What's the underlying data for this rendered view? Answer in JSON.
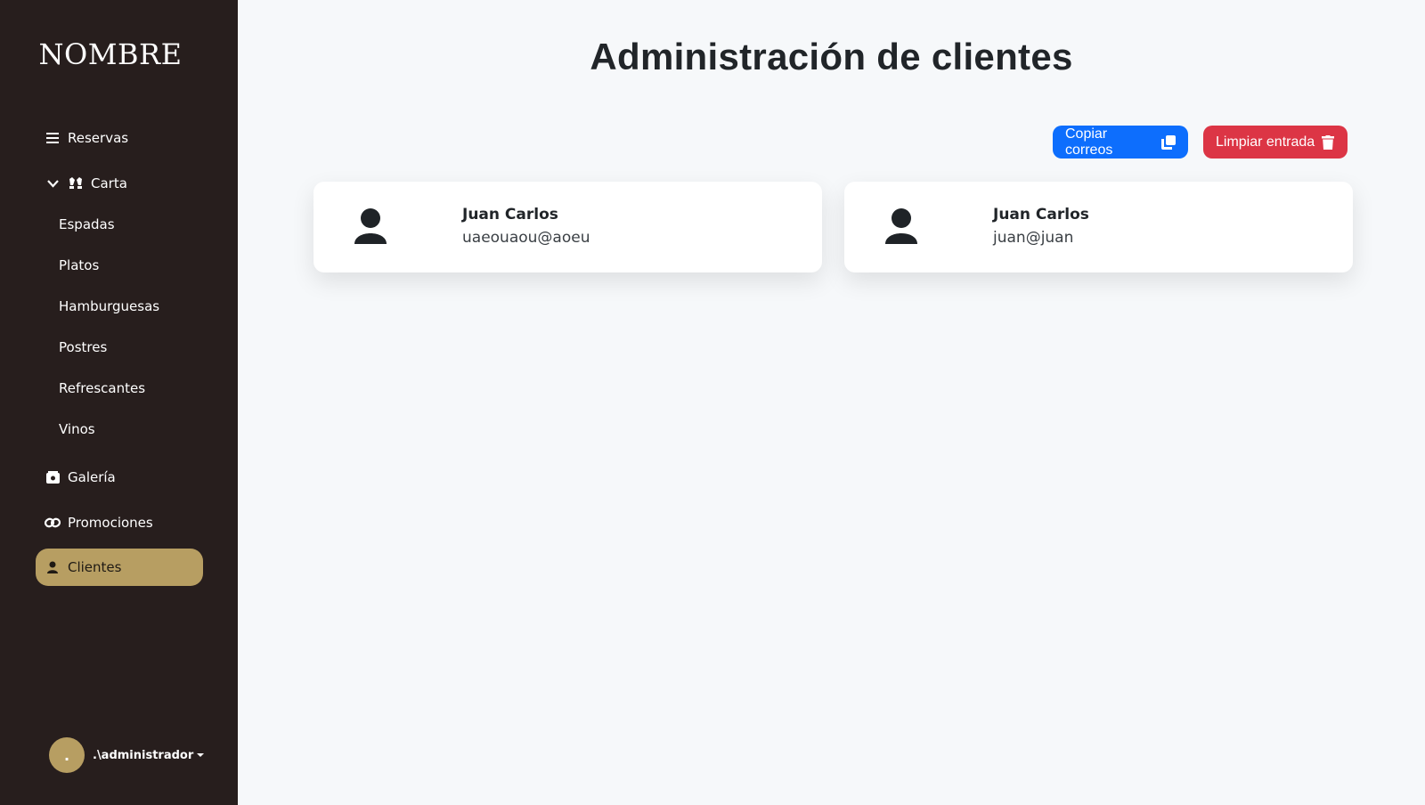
{
  "sidebar": {
    "brand": "NOMBRE",
    "items": [
      {
        "label": "Reservas",
        "icon": "list-icon"
      },
      {
        "label": "Carta",
        "icon": "cutlery-icon",
        "expanded": true,
        "children": [
          "Espadas",
          "Platos",
          "Hamburguesas",
          "Postres",
          "Refrescantes",
          "Vinos"
        ]
      },
      {
        "label": "Galería",
        "icon": "gallery-icon"
      },
      {
        "label": "Promociones",
        "icon": "link-icon"
      },
      {
        "label": "Clientes",
        "icon": "user-icon",
        "active": true
      }
    ],
    "user": {
      "avatar_text": ".",
      "name": ".\\administrador"
    }
  },
  "main": {
    "title": "Administración de clientes",
    "actions": {
      "copy_label": "Copiar correos",
      "clear_label": "Limpiar entrada"
    },
    "clients": [
      {
        "name": "Juan Carlos",
        "email": "uaeouaou@aoeu"
      },
      {
        "name": "Juan Carlos",
        "email": "juan@juan"
      }
    ]
  },
  "colors": {
    "sidebar_bg": "#271e1d",
    "accent": "#b79e62",
    "primary": "#0d6efd",
    "danger": "#dc3545",
    "page_bg": "#f6f8fa"
  }
}
